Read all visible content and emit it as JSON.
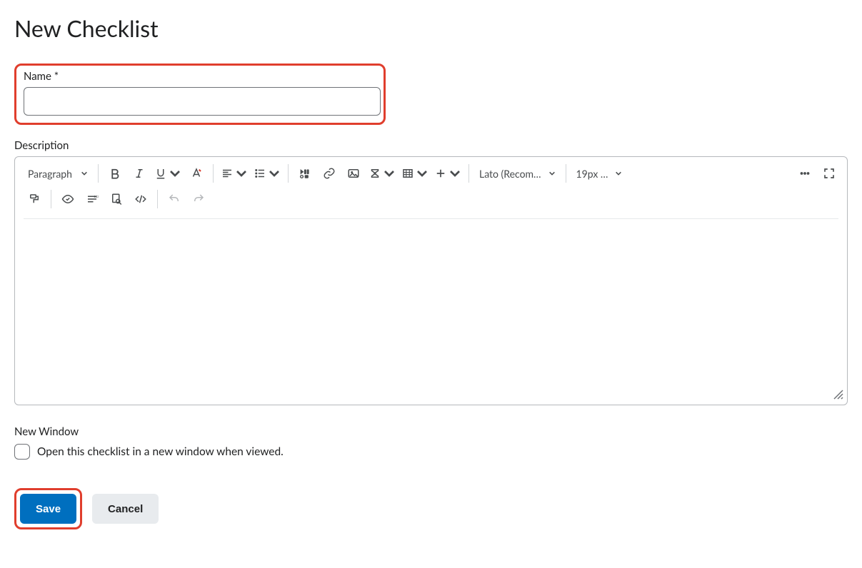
{
  "page": {
    "title": "New Checklist"
  },
  "nameField": {
    "label": "Name *",
    "value": ""
  },
  "descField": {
    "label": "Description"
  },
  "toolbar": {
    "paragraph": "Paragraph",
    "font": "Lato (Recom…",
    "size": "19px …"
  },
  "newWindow": {
    "heading": "New Window",
    "checkboxLabel": "Open this checklist in a new window when viewed."
  },
  "buttons": {
    "save": "Save",
    "cancel": "Cancel"
  }
}
